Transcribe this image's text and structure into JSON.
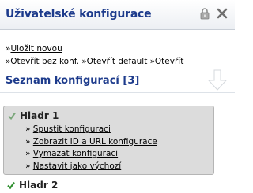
{
  "header": {
    "title": "Uživatelské konfigurace",
    "icons": {
      "lock": "lock-icon",
      "close": "close-icon"
    }
  },
  "actions": {
    "prefix": "»",
    "save_new": "Uložit novou",
    "open_without_conf": "Otevřít bez konf.",
    "open_default": "Otevřít default",
    "open": "Otevřít"
  },
  "section": {
    "title": "Seznam konfigurací [3]",
    "icon": "down-arrow-icon"
  },
  "configs": [
    {
      "name": "Hladr 1",
      "status_icon": "check-icon",
      "status_color": "#7aa67a",
      "links": [
        "Spustit konfiguraci",
        "Zobrazit ID a URL konfigurace",
        "Vymazat konfiguraci",
        "Nastavit jako výchozí"
      ]
    },
    {
      "name": "Hladr 2",
      "status_icon": "check-icon",
      "status_color": "#2f8f2f"
    }
  ],
  "colors": {
    "title_blue": "#1d3b8c",
    "box_bg": "#dcdcdc"
  }
}
